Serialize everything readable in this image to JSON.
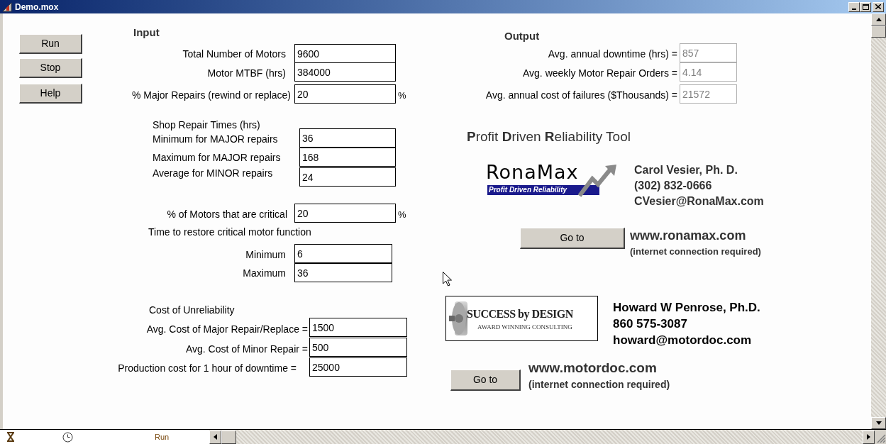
{
  "window": {
    "title": "Demo.mox"
  },
  "buttons": [
    {
      "label": "Run"
    },
    {
      "label": "Stop"
    },
    {
      "label": "Help"
    }
  ],
  "input": {
    "heading": "Input",
    "section_labels": [
      "Shop Repair Times (hrs)",
      "Time to restore critical motor function",
      "Cost of Unreliability"
    ],
    "fields": [
      {
        "label": "Total Number of Motors",
        "value": "9600",
        "read_only": false
      },
      {
        "label": "Motor MTBF (hrs)",
        "value": "384000",
        "read_only": false
      },
      {
        "label": "% Major Repairs (rewind or replace)",
        "value": "20",
        "unit": "%",
        "read_only": false
      },
      {
        "label": "Minimum for MAJOR repairs",
        "value": "36",
        "read_only": false
      },
      {
        "label": "Maximum for MAJOR repairs",
        "value": "168",
        "read_only": false
      },
      {
        "label": "Average for MINOR repairs",
        "value": "24",
        "read_only": false
      },
      {
        "label": "% of Motors that are critical",
        "value": "20",
        "unit": "%",
        "read_only": false
      },
      {
        "label": "Minimum",
        "value": "6",
        "read_only": false
      },
      {
        "label": "Maximum",
        "value": "36",
        "read_only": false
      },
      {
        "label": "Avg. Cost of Major Repair/Replace =",
        "value": "1500",
        "read_only": false
      },
      {
        "label": "Avg. Cost of Minor Repair =",
        "value": "500",
        "read_only": false
      },
      {
        "label": "Production cost for 1 hour of downtime =",
        "value": "25000",
        "read_only": false
      }
    ]
  },
  "output": {
    "heading": "Output",
    "fields": [
      {
        "label": "Avg. annual downtime (hrs) =",
        "value": "857",
        "read_only": true
      },
      {
        "label": "Avg. weekly Motor Repair Orders =",
        "value": "4.14",
        "read_only": true
      },
      {
        "label": "Avg. annual cost of failures ($Thousands) =",
        "value": "21572",
        "read_only": true
      }
    ]
  },
  "tool_title": "**P**rofit **D**riven **R**eliability Tool",
  "contacts": [
    {
      "logo": {
        "name": "RonaMax",
        "tagline": "Profit Driven Reliability"
      },
      "lines": [
        "Carol Vesier, Ph. D.",
        "(302) 832-0666",
        "CVesier@RonaMax.com"
      ],
      "button": "Go to",
      "url": "www.ronamax.com",
      "note": "(internet connection required)"
    },
    {
      "logo": {
        "name": "SUCCESS by DESIGN",
        "tagline": "AWARD WINNING CONSULTING"
      },
      "lines": [
        "Howard W Penrose, Ph.D.",
        "860 575-3087",
        "howard@motordoc.com"
      ],
      "button": "Go to",
      "url": "www.motordoc.com",
      "note": "(internet connection required)"
    }
  ],
  "status_bar": {
    "mode": "Run"
  }
}
